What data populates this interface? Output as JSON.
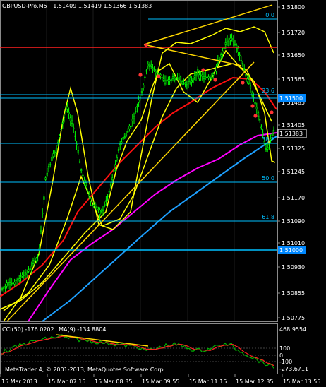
{
  "header": {
    "symbol": "GBPUSD-Pro,M5",
    "ohlc": "1.51409 1.51419 1.51366 1.51383"
  },
  "price_axis": {
    "labels": [
      "1.51800",
      "1.51720",
      "1.51650",
      "1.51565",
      "1.51485",
      "1.51405",
      "1.51325",
      "1.51245",
      "1.51170",
      "1.51090",
      "1.51010",
      "1.50930",
      "1.50855",
      "1.50775"
    ],
    "current_price": "1.51383",
    "level_1": "1.51500",
    "level_2": "1.51000"
  },
  "fibo": {
    "l0": "0.0",
    "l236": "23.6",
    "l382": "38.2",
    "l50": "50.0",
    "l618": "61.8"
  },
  "time_axis": {
    "labels": [
      "15 Mar 2013",
      "15 Mar 07:15",
      "15 Mar 08:35",
      "15 Mar 09:55",
      "15 Mar 11:15",
      "15 Mar 12:35",
      "15 Mar 13:55"
    ]
  },
  "indicator": {
    "title": "CCI(50) -176.0202",
    "ma_label": "MA(9) -134.8804",
    "levels": [
      "468.9554",
      "100",
      "0",
      "-100",
      "-273.6711"
    ]
  },
  "copyright": "MetaTrader 4, © 2001-2013, MetaQuotes Software Corp.",
  "colors": {
    "background": "#000000",
    "grid": "#1f1f1f",
    "candles": "#00ff00",
    "bollinger": "#ffff00",
    "ma_red": "#ff0000",
    "ma_magenta": "#ff00ff",
    "ma_blue": "#1ea0ff",
    "fibo_cyan": "#00bfff",
    "trendline": "#ffd700",
    "level_box": "#0088ff",
    "cci": "#00b300"
  }
}
